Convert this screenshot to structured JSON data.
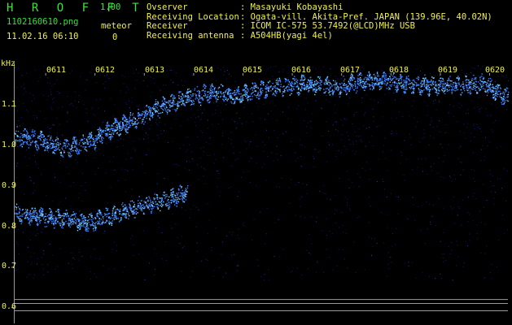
{
  "header": {
    "app_title": "H R O F F T",
    "app_version": "1.00",
    "file_name": "1102160610.png",
    "meteor_label": "meteor",
    "date_time": "11.02.16 06:10",
    "meteor_count": "0"
  },
  "info": [
    {
      "label": "Ovserver",
      "value": ": Masayuki Kobayashi"
    },
    {
      "label": "Receiving Location",
      "value": ": Ogata-vill. Akita-Pref. JAPAN (139.96E, 40.02N)"
    },
    {
      "label": "Receiver",
      "value": ": ICOM IC-575 53.7492(@LCD)MHz USB"
    },
    {
      "label": "Receiving antenna",
      "value": ": A504HB(yagi 4el)"
    }
  ],
  "colors": {
    "background": "#000000",
    "title_green": "#33e233",
    "label_yellow": "#f0f050",
    "signal_blue": "#3a7dff",
    "signal_cyan": "#7fd8ff",
    "noise_blue": "#0c1c70",
    "grid_gray": "#9a9a9a"
  },
  "chart_data": {
    "type": "scatter",
    "title": "",
    "ylabel": "kHz",
    "x_ticks": [
      "0611",
      "0612",
      "0613",
      "0614",
      "0615",
      "0616",
      "0617",
      "0618",
      "0619",
      "0620"
    ],
    "y_ticks": [
      "1.1",
      "1.0",
      "0.9",
      "0.8",
      "0.7",
      "0.6"
    ],
    "xlim": [
      0,
      10
    ],
    "ylim": [
      0.575,
      1.205
    ],
    "series": [
      {
        "key": "upper",
        "x": [
          0,
          0.5,
          1.0,
          1.5,
          2.0,
          2.5,
          3.0,
          3.5,
          4.0,
          4.5,
          5.0,
          5.5,
          6.0,
          6.5,
          7.0,
          7.5,
          8.0,
          8.5,
          9.0,
          9.5,
          10
        ],
        "y": [
          1.025,
          1.015,
          0.995,
          1.01,
          1.045,
          1.07,
          1.1,
          1.12,
          1.135,
          1.125,
          1.14,
          1.15,
          1.155,
          1.145,
          1.16,
          1.165,
          1.155,
          1.15,
          1.15,
          1.155,
          1.12
        ]
      },
      {
        "key": "lower",
        "x": [
          0,
          0.5,
          1.0,
          1.5,
          2.0,
          2.5,
          3.0,
          3.5
        ],
        "y": [
          0.835,
          0.825,
          0.82,
          0.81,
          0.83,
          0.85,
          0.865,
          0.885
        ]
      }
    ],
    "reference_lines": [
      0.62,
      0.61,
      0.592
    ]
  }
}
